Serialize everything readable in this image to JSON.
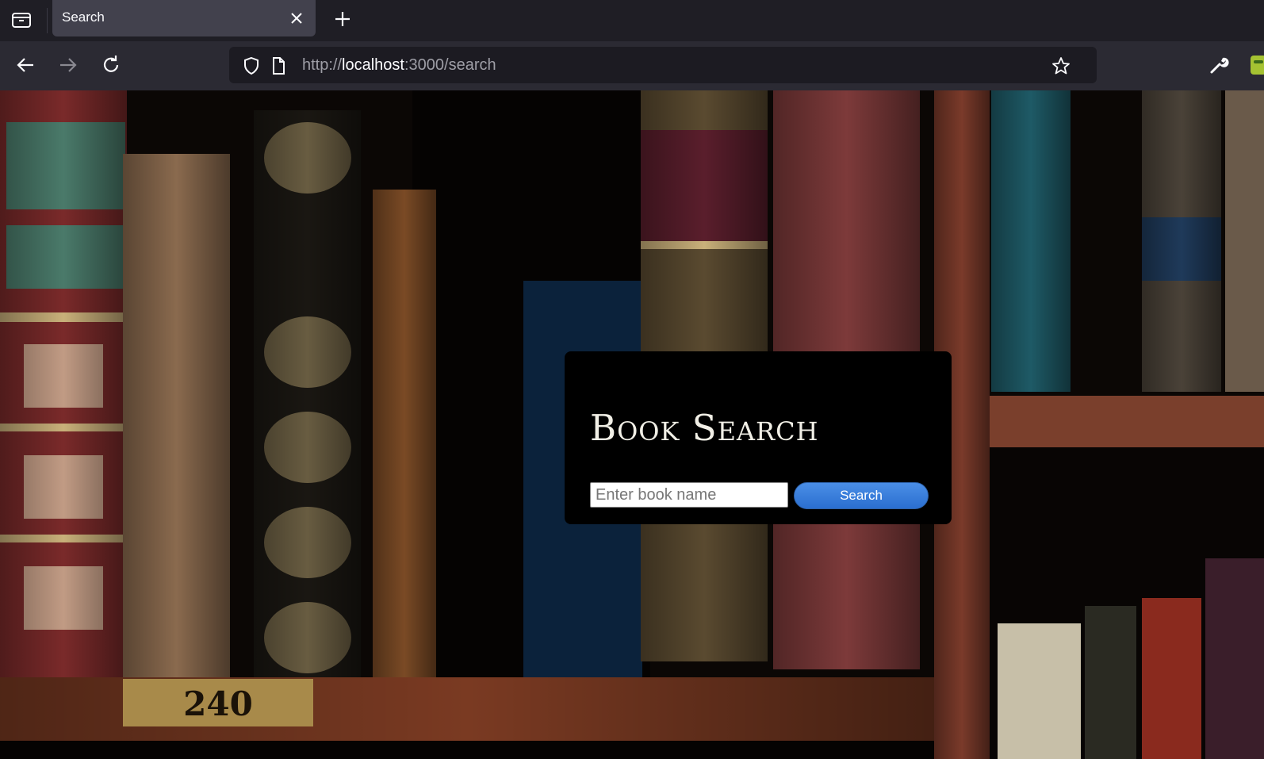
{
  "browser": {
    "tab_title": "Search",
    "url_scheme": "http://",
    "url_host": "localhost",
    "url_rest": ":3000/search"
  },
  "page": {
    "title": "Book Search",
    "search_placeholder": "Enter book name",
    "search_button_label": "Search"
  },
  "colors": {
    "panel_background": "#000000",
    "button_blue": "#2b6fd0",
    "browser_toolbar": "#2b2a33"
  }
}
